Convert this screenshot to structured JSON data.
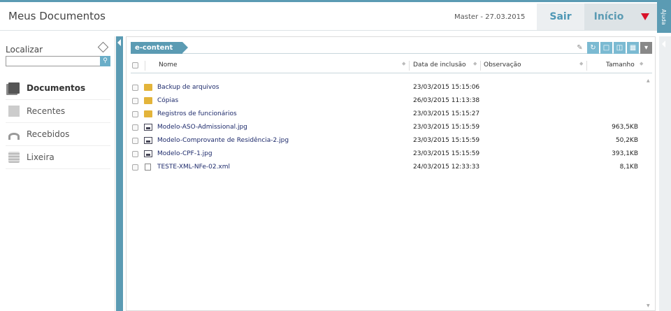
{
  "header": {
    "title": "Meus Documentos",
    "user_info": "Master  -  27.03.2015",
    "sair_label": "Sair",
    "inicio_label": "Início",
    "ajuda_label": "Ajuda"
  },
  "sidebar": {
    "search_label": "Localizar",
    "search_value": "",
    "items": [
      {
        "label": "Documentos",
        "icon": "documents-icon",
        "active": true
      },
      {
        "label": "Recentes",
        "icon": "recent-icon",
        "active": false
      },
      {
        "label": "Recebidos",
        "icon": "received-icon",
        "active": false
      },
      {
        "label": "Lixeira",
        "icon": "trash-icon",
        "active": false
      }
    ]
  },
  "main": {
    "breadcrumb": "e-content",
    "columns": {
      "name": "Nome",
      "date": "Data de inclusão",
      "note": "Observação",
      "size": "Tamanho"
    },
    "files": [
      {
        "name": "Backup de arquivos",
        "type": "folder",
        "date": "23/03/2015 15:15:06",
        "size": ""
      },
      {
        "name": "Cópias",
        "type": "folder",
        "date": "26/03/2015 11:13:38",
        "size": ""
      },
      {
        "name": "Registros de funcionários",
        "type": "folder",
        "date": "23/03/2015 15:15:27",
        "size": ""
      },
      {
        "name": "Modelo-ASO-Admissional.jpg",
        "type": "image",
        "date": "23/03/2015 15:15:59",
        "size": "963,5KB"
      },
      {
        "name": "Modelo-Comprovante de Residência-2.jpg",
        "type": "image",
        "date": "23/03/2015 15:15:59",
        "size": "50,2KB"
      },
      {
        "name": "Modelo-CPF-1.jpg",
        "type": "image",
        "date": "23/03/2015 15:15:59",
        "size": "393,1KB"
      },
      {
        "name": "TESTE-XML-NFe-02.xml",
        "type": "xml",
        "date": "24/03/2015 12:33:33",
        "size": "8,1KB"
      }
    ]
  },
  "colors": {
    "accent": "#5b9bb3",
    "menu_arrow": "#d9122a",
    "link": "#1d2a6b"
  }
}
